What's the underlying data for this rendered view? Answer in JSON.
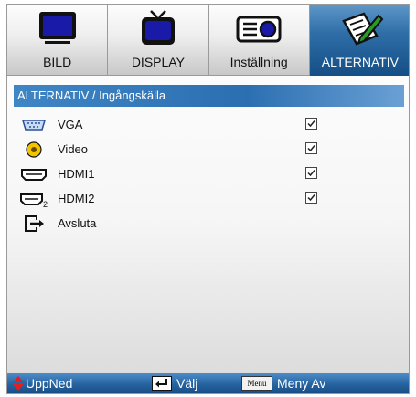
{
  "tabs": [
    {
      "label": "BILD",
      "icon": "monitor-icon",
      "active": false
    },
    {
      "label": "DISPLAY",
      "icon": "tv-icon",
      "active": false
    },
    {
      "label": "Inställning",
      "icon": "projector-icon",
      "active": false
    },
    {
      "label": "ALTERNATIV",
      "icon": "notepad-pen-icon",
      "active": true
    }
  ],
  "breadcrumb": "ALTERNATIV / Ingångskälla",
  "menu": {
    "items": [
      {
        "label": "VGA",
        "icon": "vga-port-icon",
        "checked": true
      },
      {
        "label": "Video",
        "icon": "video-rca-icon",
        "checked": true
      },
      {
        "label": "HDMI1",
        "icon": "hdmi-port-icon",
        "checked": true
      },
      {
        "label": "HDMI2",
        "icon": "hdmi2-port-icon",
        "checked": true
      },
      {
        "label": "Avsluta",
        "icon": "exit-icon",
        "checked": null
      }
    ]
  },
  "footer": {
    "updown_label": "UppNed",
    "select_label": "Välj",
    "menu_key": "Menu",
    "menu_off_label": "Meny Av"
  },
  "colors": {
    "accent_blue": "#2c6fb1",
    "icon_blue": "#1a1aa8",
    "icon_yellow": "#f2c400"
  }
}
